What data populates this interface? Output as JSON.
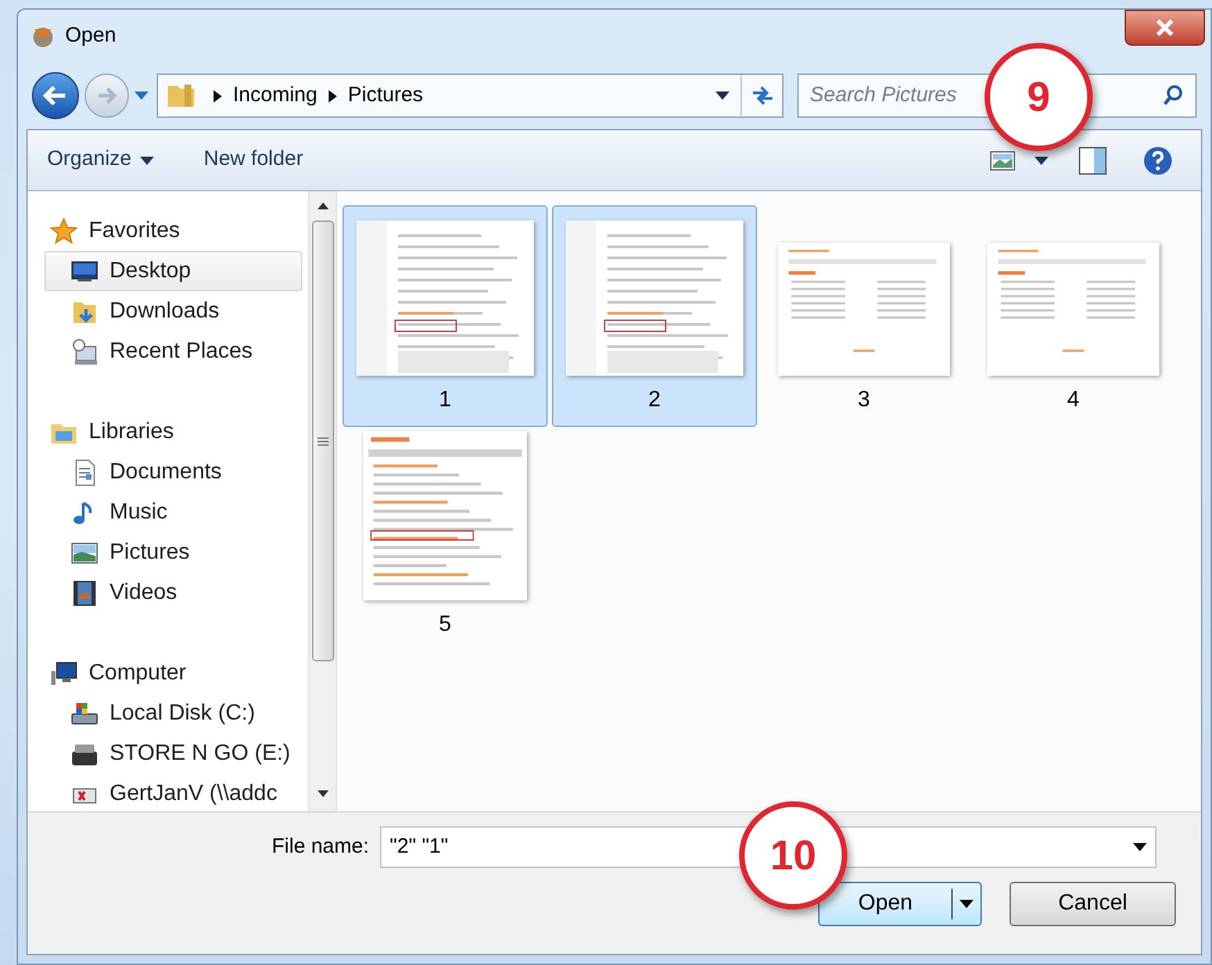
{
  "window": {
    "title": "Open"
  },
  "address": {
    "path": [
      "Incoming",
      "Pictures"
    ]
  },
  "search": {
    "placeholder": "Search Pictures"
  },
  "toolbar": {
    "organize": "Organize",
    "new_folder": "New folder"
  },
  "nav": [
    {
      "label": "Favorites",
      "kind": "star",
      "children": [
        {
          "label": "Desktop",
          "kind": "desktop",
          "selected": true
        },
        {
          "label": "Downloads",
          "kind": "downloads",
          "selected": false
        },
        {
          "label": "Recent Places",
          "kind": "recent",
          "selected": false
        }
      ]
    },
    {
      "label": "Libraries",
      "kind": "library",
      "children": [
        {
          "label": "Documents",
          "kind": "documents",
          "selected": false
        },
        {
          "label": "Music",
          "kind": "music",
          "selected": false
        },
        {
          "label": "Pictures",
          "kind": "pictures",
          "selected": false
        },
        {
          "label": "Videos",
          "kind": "videos",
          "selected": false
        }
      ]
    },
    {
      "label": "Computer",
      "kind": "computer",
      "children": [
        {
          "label": "Local Disk (C:)",
          "kind": "disk",
          "selected": false
        },
        {
          "label": "STORE N GO (E:)",
          "kind": "usb",
          "selected": false
        },
        {
          "label": "GertJanV (\\\\addc",
          "kind": "network",
          "selected": false
        }
      ]
    }
  ],
  "files": [
    {
      "label": "1",
      "kind": "sidebar-doc",
      "selected": true
    },
    {
      "label": "2",
      "kind": "sidebar-doc",
      "selected": true
    },
    {
      "label": "3",
      "kind": "wide-doc",
      "selected": false
    },
    {
      "label": "4",
      "kind": "wide-doc",
      "selected": false
    },
    {
      "label": "5",
      "kind": "form-doc",
      "selected": false
    }
  ],
  "file_name": {
    "label": "File name:",
    "value": "\"2\" \"1\""
  },
  "buttons": [
    {
      "label": "Open",
      "kind": "split",
      "default": true
    },
    {
      "label": "Cancel",
      "kind": "plain",
      "default": false
    }
  ],
  "callouts": [
    {
      "label": "9"
    },
    {
      "label": "10"
    }
  ]
}
